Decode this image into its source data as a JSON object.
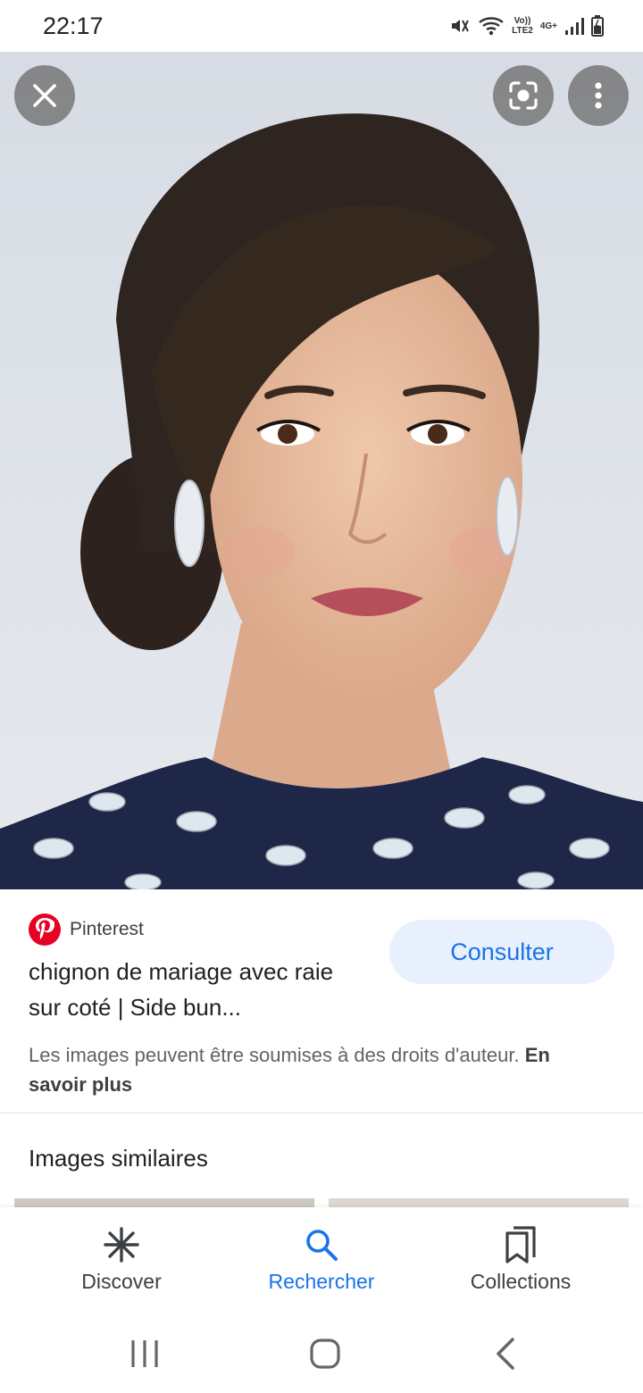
{
  "status_bar": {
    "time": "22:17",
    "network_top": "Vo))",
    "network_bottom": "LTE2",
    "network_type": "4G+",
    "icons": [
      "mute-icon",
      "wifi-icon",
      "signal-icon",
      "battery-icon"
    ]
  },
  "image_viewer": {
    "close_icon": "close-icon",
    "lens_icon": "lens-icon",
    "more_icon": "more-vert-icon"
  },
  "result": {
    "source": "Pinterest",
    "title": "chignon de mariage avec raie sur coté | Side bun...",
    "visit_label": "Consulter",
    "rights_text": "Les images peuvent être soumises à des droits d'auteur.",
    "learn_more": "En savoir plus"
  },
  "similar": {
    "title": "Images similaires"
  },
  "bottom_nav": {
    "items": [
      {
        "label": "Discover",
        "icon": "asterisk-icon",
        "active": false
      },
      {
        "label": "Rechercher",
        "icon": "search-icon",
        "active": true
      },
      {
        "label": "Collections",
        "icon": "bookmarks-icon",
        "active": false
      }
    ]
  },
  "system_nav": {
    "icons": [
      "recent-apps-icon",
      "home-icon",
      "back-icon"
    ]
  },
  "colors": {
    "accent": "#1a73e8",
    "accent_bg": "#e8f0fe",
    "pinterest": "#e60023"
  }
}
